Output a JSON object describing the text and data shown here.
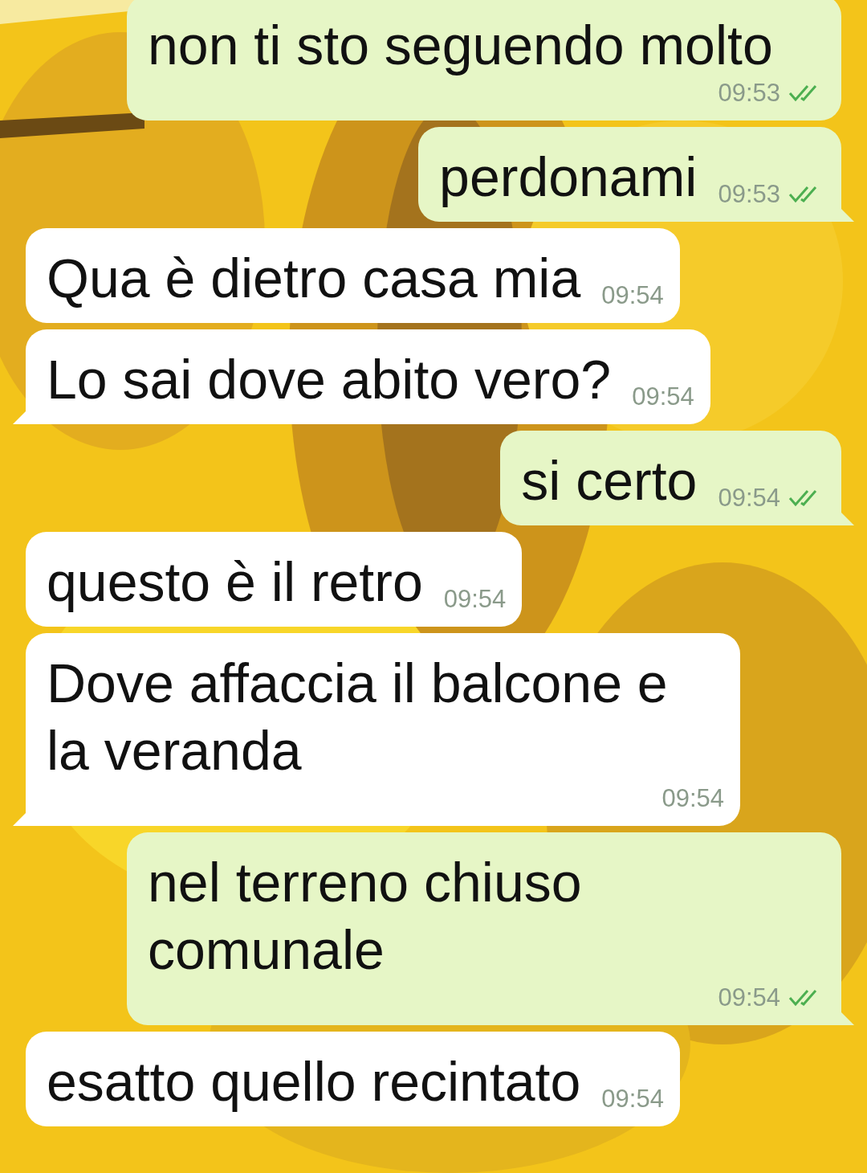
{
  "messages": [
    {
      "outgoing": true,
      "text": "non ti sto seguendo molto",
      "time": "09:53",
      "read": true,
      "tail": false
    },
    {
      "outgoing": true,
      "text": "perdonami",
      "time": "09:53",
      "read": true,
      "tail": true
    },
    {
      "outgoing": false,
      "text": "Qua è dietro casa mia",
      "time": "09:54",
      "tail": false
    },
    {
      "outgoing": false,
      "text": "Lo sai dove abito vero?",
      "time": "09:54",
      "tail": true
    },
    {
      "outgoing": true,
      "text": "si certo",
      "time": "09:54",
      "read": true,
      "tail": true
    },
    {
      "outgoing": false,
      "text": "questo è il retro",
      "time": "09:54",
      "tail": false
    },
    {
      "outgoing": false,
      "text": "Dove affaccia il balcone e la veranda",
      "time": "09:54",
      "tail": true
    },
    {
      "outgoing": true,
      "text": "nel terreno chiuso comunale",
      "time": "09:54",
      "read": true,
      "tail": true
    },
    {
      "outgoing": false,
      "text": "esatto quello recintato",
      "time": "09:54",
      "tail": false
    }
  ]
}
